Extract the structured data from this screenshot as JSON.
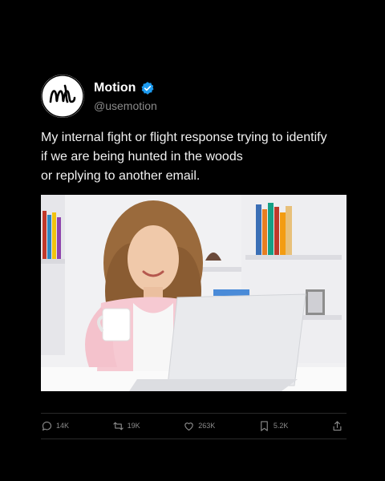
{
  "account": {
    "display_name": "Motion",
    "handle": "@usemotion",
    "verified": true,
    "avatar_icon": "motion-logo-icon"
  },
  "tweet": {
    "lines": [
      "My internal fight or flight response trying to identify",
      "if we are being hunted in the woods",
      "or replying to another email."
    ]
  },
  "media": {
    "alt": "woman-with-coffee-mug-smiling-at-laptop"
  },
  "actions": {
    "replies": "14K",
    "retweets": "19K",
    "likes": "263K",
    "bookmarks": "5.2K"
  },
  "colors": {
    "background": "#000000",
    "verified_badge": "#1d9bf0",
    "muted_text": "#8b8b8b"
  }
}
